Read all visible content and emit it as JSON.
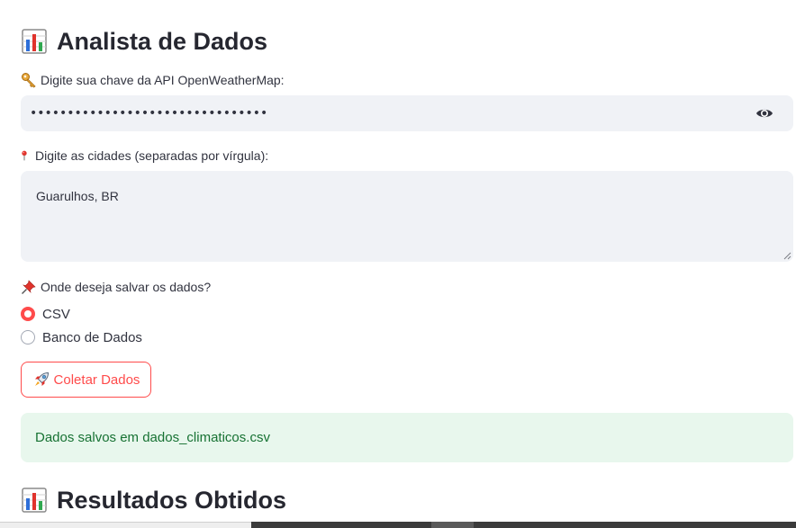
{
  "header": {
    "title": "Analista de Dados",
    "icon": "bar-chart-emoji"
  },
  "api_key": {
    "label": "Digite sua chave da API OpenWeatherMap:",
    "label_icon": "key-emoji",
    "value": "••••••••••••••••••••••••••••••••",
    "toggle_icon": "eye-icon"
  },
  "cities": {
    "label": "Digite as cidades (separadas por vírgula):",
    "label_icon": "round-pushpin-emoji",
    "value": "Guarulhos, BR"
  },
  "save_option": {
    "label": "Onde deseja salvar os dados?",
    "label_icon": "pushpin-emoji",
    "options": [
      {
        "label": "CSV",
        "selected": true
      },
      {
        "label": "Banco de Dados",
        "selected": false
      }
    ]
  },
  "collect_button": {
    "label": "Coletar Dados",
    "icon": "rocket-emoji"
  },
  "status": {
    "message": "Dados salvos em dados_climaticos.csv"
  },
  "results": {
    "title": "Resultados Obtidos",
    "icon": "bar-chart-emoji"
  },
  "colors": {
    "accent": "#ff4b4b",
    "input_bg": "#f0f2f6",
    "success_bg": "#e8f7ed",
    "success_text": "#177233"
  }
}
